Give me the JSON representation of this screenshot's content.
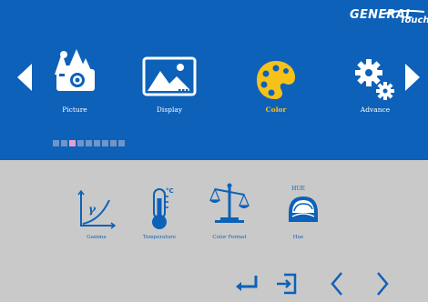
{
  "brand": {
    "name": "GENERAL",
    "suffix": "Touch"
  },
  "colors": {
    "top_bg": "#0d61b8",
    "bottom_bg": "#c9c9c9",
    "selected": "#f6c21a",
    "sub_label": "#0d61b8"
  },
  "menu": {
    "items": [
      {
        "label": "Picture",
        "icon": "camera-landscape-icon",
        "selected": false
      },
      {
        "label": "Display",
        "icon": "display-image-icon",
        "selected": false
      },
      {
        "label": "Color",
        "icon": "palette-icon",
        "selected": true
      },
      {
        "label": "Advance",
        "icon": "gears-icon",
        "selected": false
      }
    ],
    "page_indicator": {
      "count": 9,
      "active_index": 2
    }
  },
  "submenu": {
    "items": [
      {
        "label": "Gamma",
        "icon": "gamma-curve-icon"
      },
      {
        "label": "Temperature",
        "icon": "thermometer-icon"
      },
      {
        "label": "Color Format",
        "icon": "scale-icon"
      },
      {
        "label": "Hue",
        "icon": "hue-icon",
        "icon_text": "HUE"
      }
    ]
  },
  "nav": [
    "enter-icon",
    "exit-icon",
    "previous-icon",
    "next-icon"
  ]
}
